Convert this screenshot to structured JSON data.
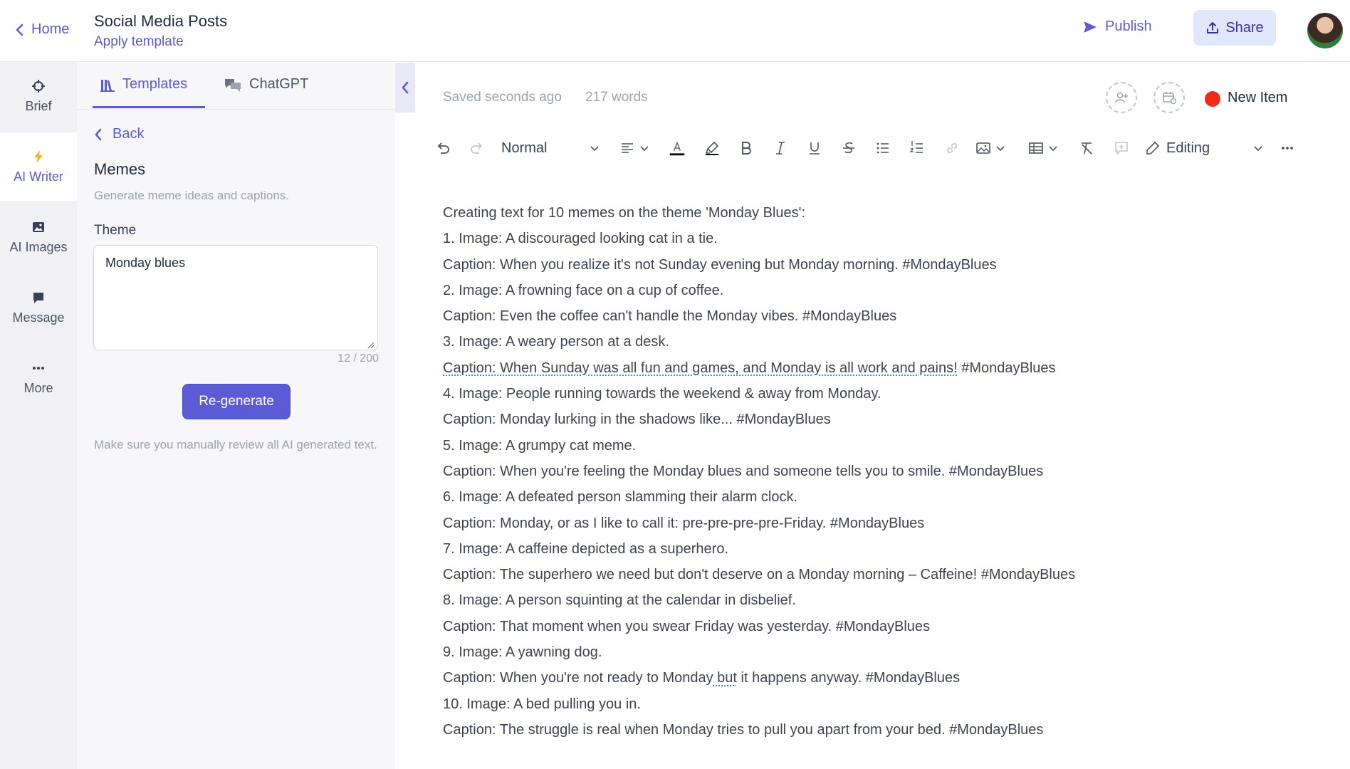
{
  "header": {
    "back_label": "Home",
    "title": "Social Media Posts",
    "subtitle": "Apply template",
    "publish_label": "Publish",
    "share_label": "Share"
  },
  "rail": {
    "items": [
      {
        "label": "Brief",
        "icon": "crosshair-icon"
      },
      {
        "label": "AI Writer",
        "icon": "lightning-icon"
      },
      {
        "label": "AI Images",
        "icon": "image-icon"
      },
      {
        "label": "Message",
        "icon": "chat-bubble-icon"
      },
      {
        "label": "More",
        "icon": "more-dots-icon"
      }
    ],
    "active": "AI Writer"
  },
  "panel": {
    "tabs": [
      {
        "label": "Templates",
        "icon": "library-icon",
        "active": true
      },
      {
        "label": "ChatGPT",
        "icon": "chat-bubbles-icon",
        "active": false
      }
    ],
    "back_label": "Back",
    "template_title": "Memes",
    "template_desc": "Generate meme ideas and captions.",
    "field_label": "Theme",
    "field_value": "Monday blues",
    "char_count": "12 / 200",
    "regenerate_label": "Re-generate",
    "disclaimer": "Make sure you manually review all AI generated text."
  },
  "editor": {
    "saved_status": "Saved seconds ago",
    "word_count": "217 words",
    "item_status": "New Item",
    "item_status_color": "#ef2b12",
    "toolbar": {
      "block_style": "Normal",
      "mode": "Editing"
    },
    "paragraphs": [
      "Creating text for 10 memes on the theme 'Monday Blues':",
      "1. Image: A discouraged looking cat in a tie.",
      "Caption: When you realize it's not Sunday evening but Monday morning. #MondayBlues",
      "2. Image: A frowning face on a cup of coffee.",
      "Caption: Even the coffee can't handle the Monday vibes. #MondayBlues",
      "3. Image: A weary person at a desk.",
      {
        "underlined": "Caption: When Sunday was all fun and games, and Monday is all work and pains!",
        "rest": " #MondayBlues"
      },
      "4. Image: People running towards the weekend & away from Monday.",
      "Caption: Monday lurking in the shadows like... #MondayBlues",
      "5. Image: A grumpy cat meme.",
      "Caption: When you're feeling the Monday blues and someone tells you to smile. #MondayBlues",
      "6. Image: A defeated person slamming their alarm clock.",
      "Caption: Monday, or as I like to call it: pre-pre-pre-pre-Friday. #MondayBlues",
      "7. Image: A caffeine depicted as a superhero.",
      "Caption: The superhero we need but don't deserve on a Monday morning – Caffeine! #MondayBlues",
      "8. Image: A person squinting at the calendar in disbelief.",
      "Caption: That moment when you swear Friday was yesterday. #MondayBlues",
      "9. Image: A yawning dog.",
      {
        "before": "Caption: When you're not ready to Monday",
        "underlined": " but",
        "rest": " it happens anyway. #MondayBlues"
      },
      "10. Image: A bed pulling you in.",
      "Caption: The struggle is real when Monday tries to pull you apart from your bed. #MondayBlues"
    ]
  },
  "colors": {
    "accent": "#5b5bd6",
    "share_bg": "#e0e7ff",
    "rail_bg": "#f1f1f5",
    "panel_bg": "#f7f7f9"
  }
}
